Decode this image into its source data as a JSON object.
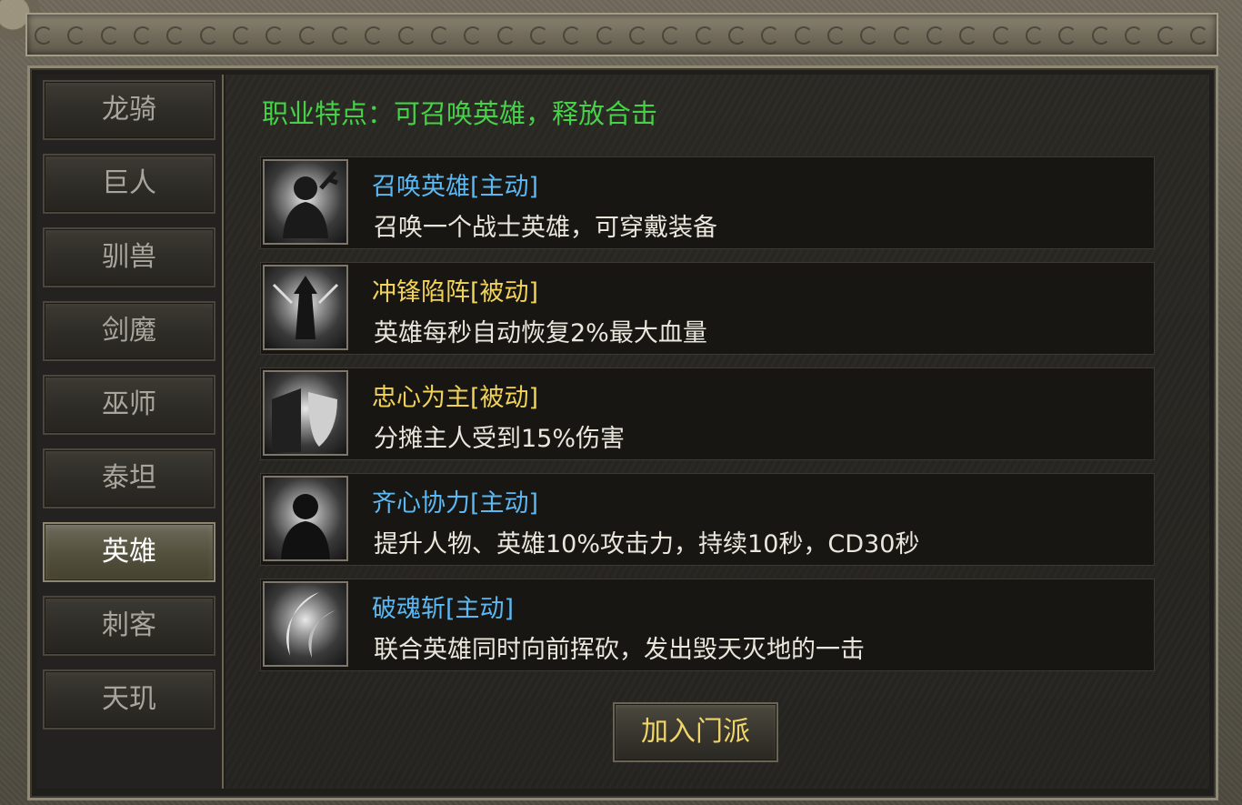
{
  "classes": [
    {
      "label": "龙骑"
    },
    {
      "label": "巨人"
    },
    {
      "label": "驯兽"
    },
    {
      "label": "剑魔"
    },
    {
      "label": "巫师"
    },
    {
      "label": "泰坦"
    },
    {
      "label": "英雄",
      "selected": true
    },
    {
      "label": "刺客"
    },
    {
      "label": "天玑"
    }
  ],
  "feature": "职业特点：可召唤英雄，释放合击",
  "skills": [
    {
      "name": "召唤英雄[主动]",
      "desc": "召唤一个战士英雄，可穿戴装备",
      "name_color": "#5cb8f2",
      "icon": "summon-hero-icon"
    },
    {
      "name": "冲锋陷阵[被动]",
      "desc": "英雄每秒自动恢复2%最大血量",
      "name_color": "#f2d35a",
      "icon": "charge-icon"
    },
    {
      "name": "忠心为主[被动]",
      "desc": "分摊主人受到15%伤害",
      "name_color": "#f2d35a",
      "icon": "loyal-shield-icon"
    },
    {
      "name": "齐心协力[主动]",
      "desc": "提升人物、英雄10%攻击力，持续10秒，CD30秒",
      "name_color": "#5cb8f2",
      "icon": "unity-icon"
    },
    {
      "name": "破魂斩[主动]",
      "desc": "联合英雄同时向前挥砍，发出毁天灭地的一击",
      "name_color": "#5cb8f2",
      "icon": "soul-slash-icon"
    }
  ],
  "join_button": "加入门派",
  "colors": {
    "feature": "#46d148",
    "active_skill": "#5cb8f2",
    "passive_skill": "#f2d35a",
    "button_text": "#f0d66a"
  }
}
